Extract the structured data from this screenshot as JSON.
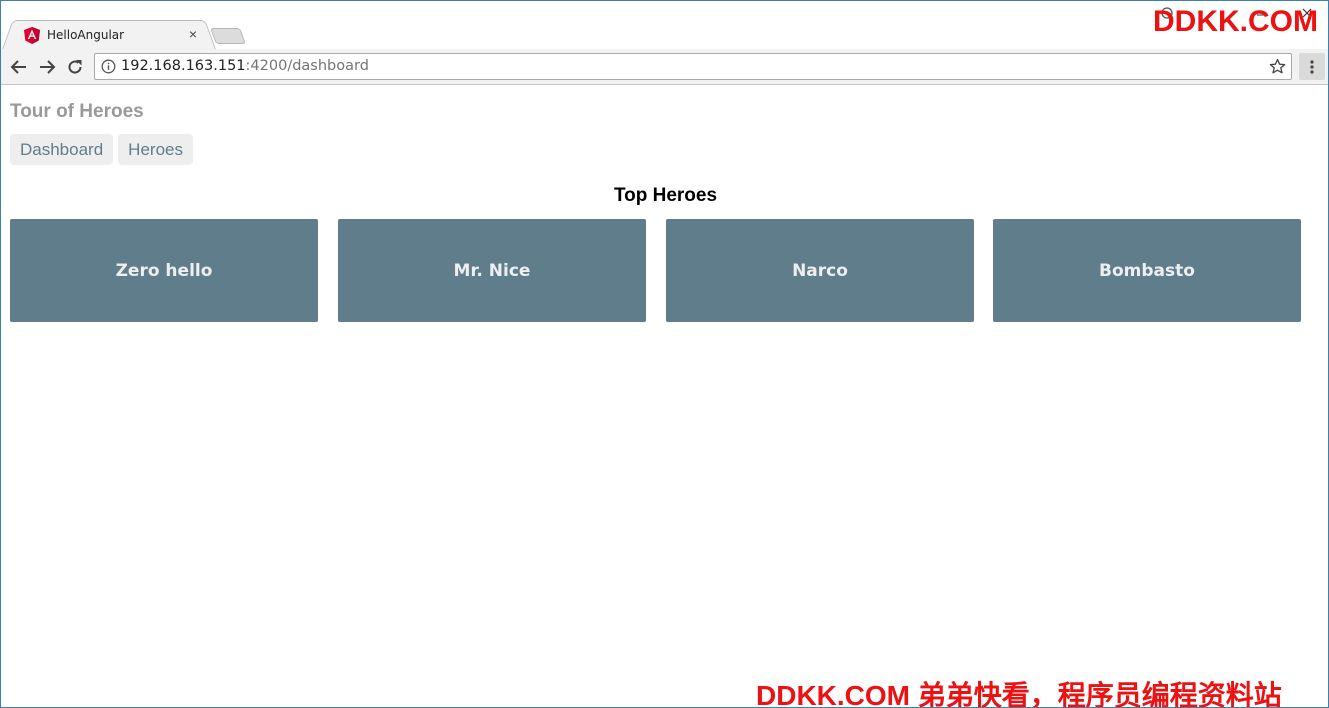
{
  "browser": {
    "tab": {
      "title": "HelloAngular",
      "close": "×"
    },
    "address": {
      "host": "192.168.163.151",
      "rest": ":4200/dashboard"
    }
  },
  "app": {
    "title": "Tour of Heroes",
    "nav": [
      {
        "label": "Dashboard"
      },
      {
        "label": "Heroes"
      }
    ]
  },
  "dashboard": {
    "heading": "Top Heroes",
    "heroes": [
      {
        "name": "Zero hello"
      },
      {
        "name": "Mr. Nice"
      },
      {
        "name": "Narco"
      },
      {
        "name": "Bombasto"
      }
    ]
  },
  "watermark": {
    "top": "DDKK.COM",
    "bottom": "DDKK.COM 弟弟快看，程序员编程资料站"
  },
  "colors": {
    "hero_card": "#607d8b",
    "nav_link_bg": "#eeeeee",
    "nav_link_text": "#607d8b",
    "app_title": "#999999",
    "watermark": "#ee1111",
    "angular_red": "#dd0031"
  }
}
